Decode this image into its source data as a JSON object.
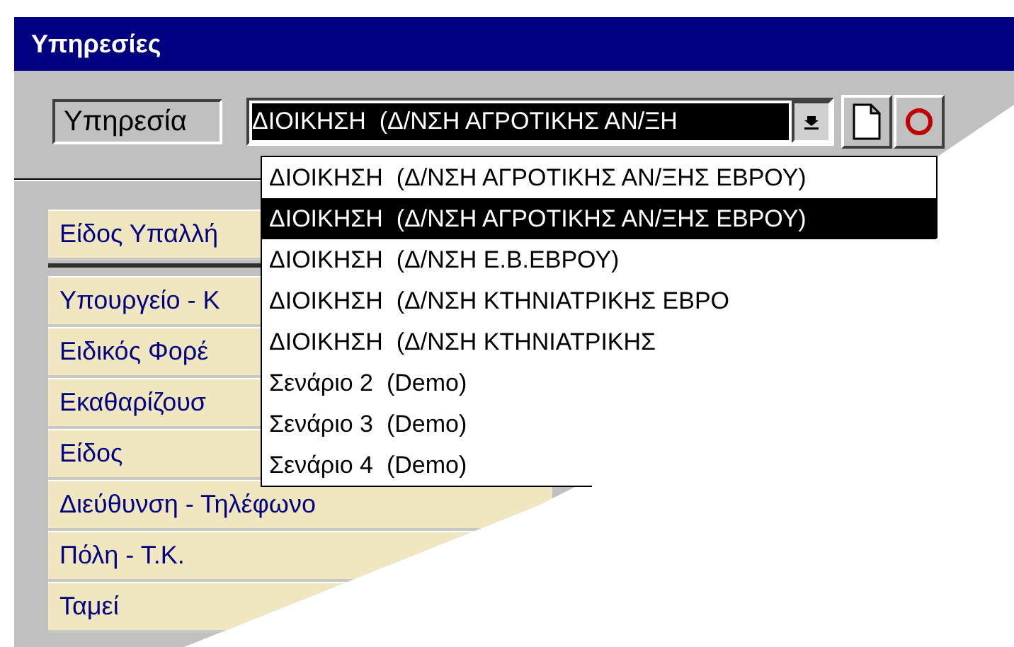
{
  "window": {
    "title": "Υπηρεσίες"
  },
  "service": {
    "label": "Υπηρεσία",
    "value": "ΔΙΟΙΚΗΣΗ  (Δ/ΝΣΗ ΑΓΡΟΤΙΚΗΣ ΑΝ/ΞΗ",
    "expanded": true
  },
  "dropdown_options": [
    {
      "label": "ΔΙΟΙΚΗΣΗ  (Δ/ΝΣΗ ΑΓΡΟΤΙΚΗΣ ΑΝ/ΞΗΣ ΕΒΡΟΥ)",
      "selected": false
    },
    {
      "label": "ΔΙΟΙΚΗΣΗ  (Δ/ΝΣΗ ΑΓΡΟΤΙΚΗΣ ΑΝ/ΞΗΣ ΕΒΡΟΥ)",
      "selected": true
    },
    {
      "label": "ΔΙΟΙΚΗΣΗ  (Δ/ΝΣΗ Ε.Β.ΕΒΡΟΥ)",
      "selected": false
    },
    {
      "label": "ΔΙΟΙΚΗΣΗ  (Δ/ΝΣΗ ΚΤΗΝΙΑΤΡΙΚΗΣ ΕΒΡΟ",
      "selected": false
    },
    {
      "label": "ΔΙΟΙΚΗΣΗ  (Δ/ΝΣΗ ΚΤΗΝΙΑΤΡΙΚΗΣ",
      "selected": false
    },
    {
      "label": "Σενάριο 2  (Demo)",
      "selected": false
    },
    {
      "label": "Σενάριο 3  (Demo)",
      "selected": false
    },
    {
      "label": "Σενάριο 4  (Demo)",
      "selected": false
    }
  ],
  "header_field": "Είδος Υπαλλή",
  "fields": [
    "Υπουργείο - Κ",
    "Ειδικός Φορέ",
    "Εκαθαρίζουσ",
    "Είδος",
    "Διεύθυνση - Τηλέφωνο",
    "Πόλη - Τ.Κ.",
    "Ταμεί"
  ]
}
